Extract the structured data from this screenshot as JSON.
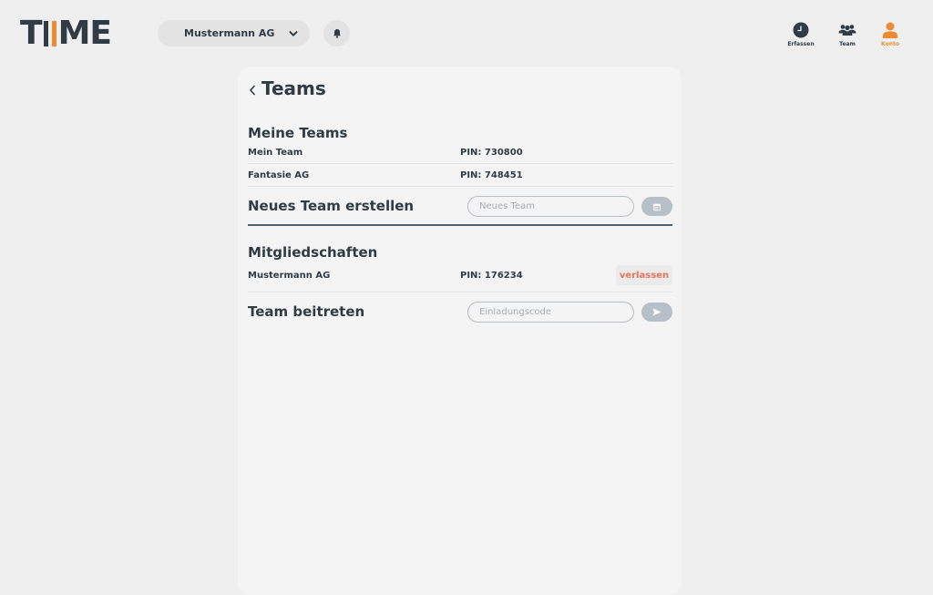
{
  "header": {
    "logo": {
      "part1": "T",
      "part2": "ME"
    },
    "company_select": {
      "value": "Mustermann AG"
    },
    "nav": [
      {
        "label": "Erfassen",
        "icon": "clock-icon"
      },
      {
        "label": "Team",
        "icon": "team-icon"
      },
      {
        "label": "Konto",
        "icon": "user-icon",
        "active": true
      }
    ]
  },
  "page": {
    "title": "Teams"
  },
  "my_teams": {
    "title": "Meine Teams",
    "rows": [
      {
        "name": "Mein Team",
        "pin": "PIN: 730800"
      },
      {
        "name": "Fantasie AG",
        "pin": "PIN: 748451"
      }
    ]
  },
  "create_team": {
    "title": "Neues Team erstellen",
    "placeholder": "Neues Team"
  },
  "memberships": {
    "title": "Mitgliedschaften",
    "rows": [
      {
        "name": "Mustermann AG",
        "pin": "PIN: 176234",
        "action": "verlassen"
      }
    ]
  },
  "join_team": {
    "title": "Team beitreten",
    "placeholder": "Einladungscode"
  },
  "colors": {
    "accent": "#ee8a33",
    "text": "#2f3b45",
    "danger": "#e8735a",
    "button": "#b7c0c8"
  }
}
